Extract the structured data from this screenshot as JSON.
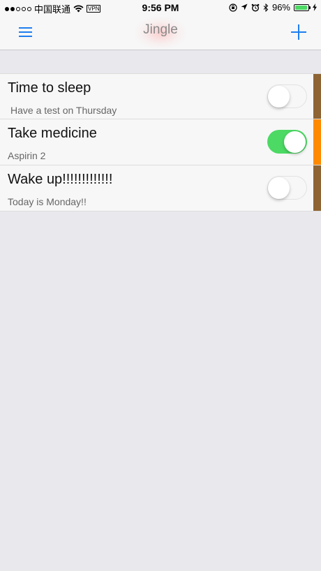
{
  "status_bar": {
    "carrier": "中国联通",
    "vpn": "VPN",
    "time": "9:56 PM",
    "battery_percent": "96%",
    "battery_level": 0.96
  },
  "nav": {
    "title": "Jingle"
  },
  "reminders": [
    {
      "title": "Time to sleep",
      "subtitle": "Have a test on Thursday",
      "enabled": false,
      "tag_color": "#8e6434"
    },
    {
      "title": "Take medicine",
      "subtitle": "Aspirin 2",
      "enabled": true,
      "tag_color": "#ff8a00"
    },
    {
      "title": "Wake up!!!!!!!!!!!!!",
      "subtitle": "Today is Monday!!",
      "enabled": false,
      "tag_color": "#8e6434"
    }
  ],
  "colors": {
    "accent": "#1e7ef0",
    "toggle_on": "#4cd964",
    "background": "#e9e8ed"
  }
}
